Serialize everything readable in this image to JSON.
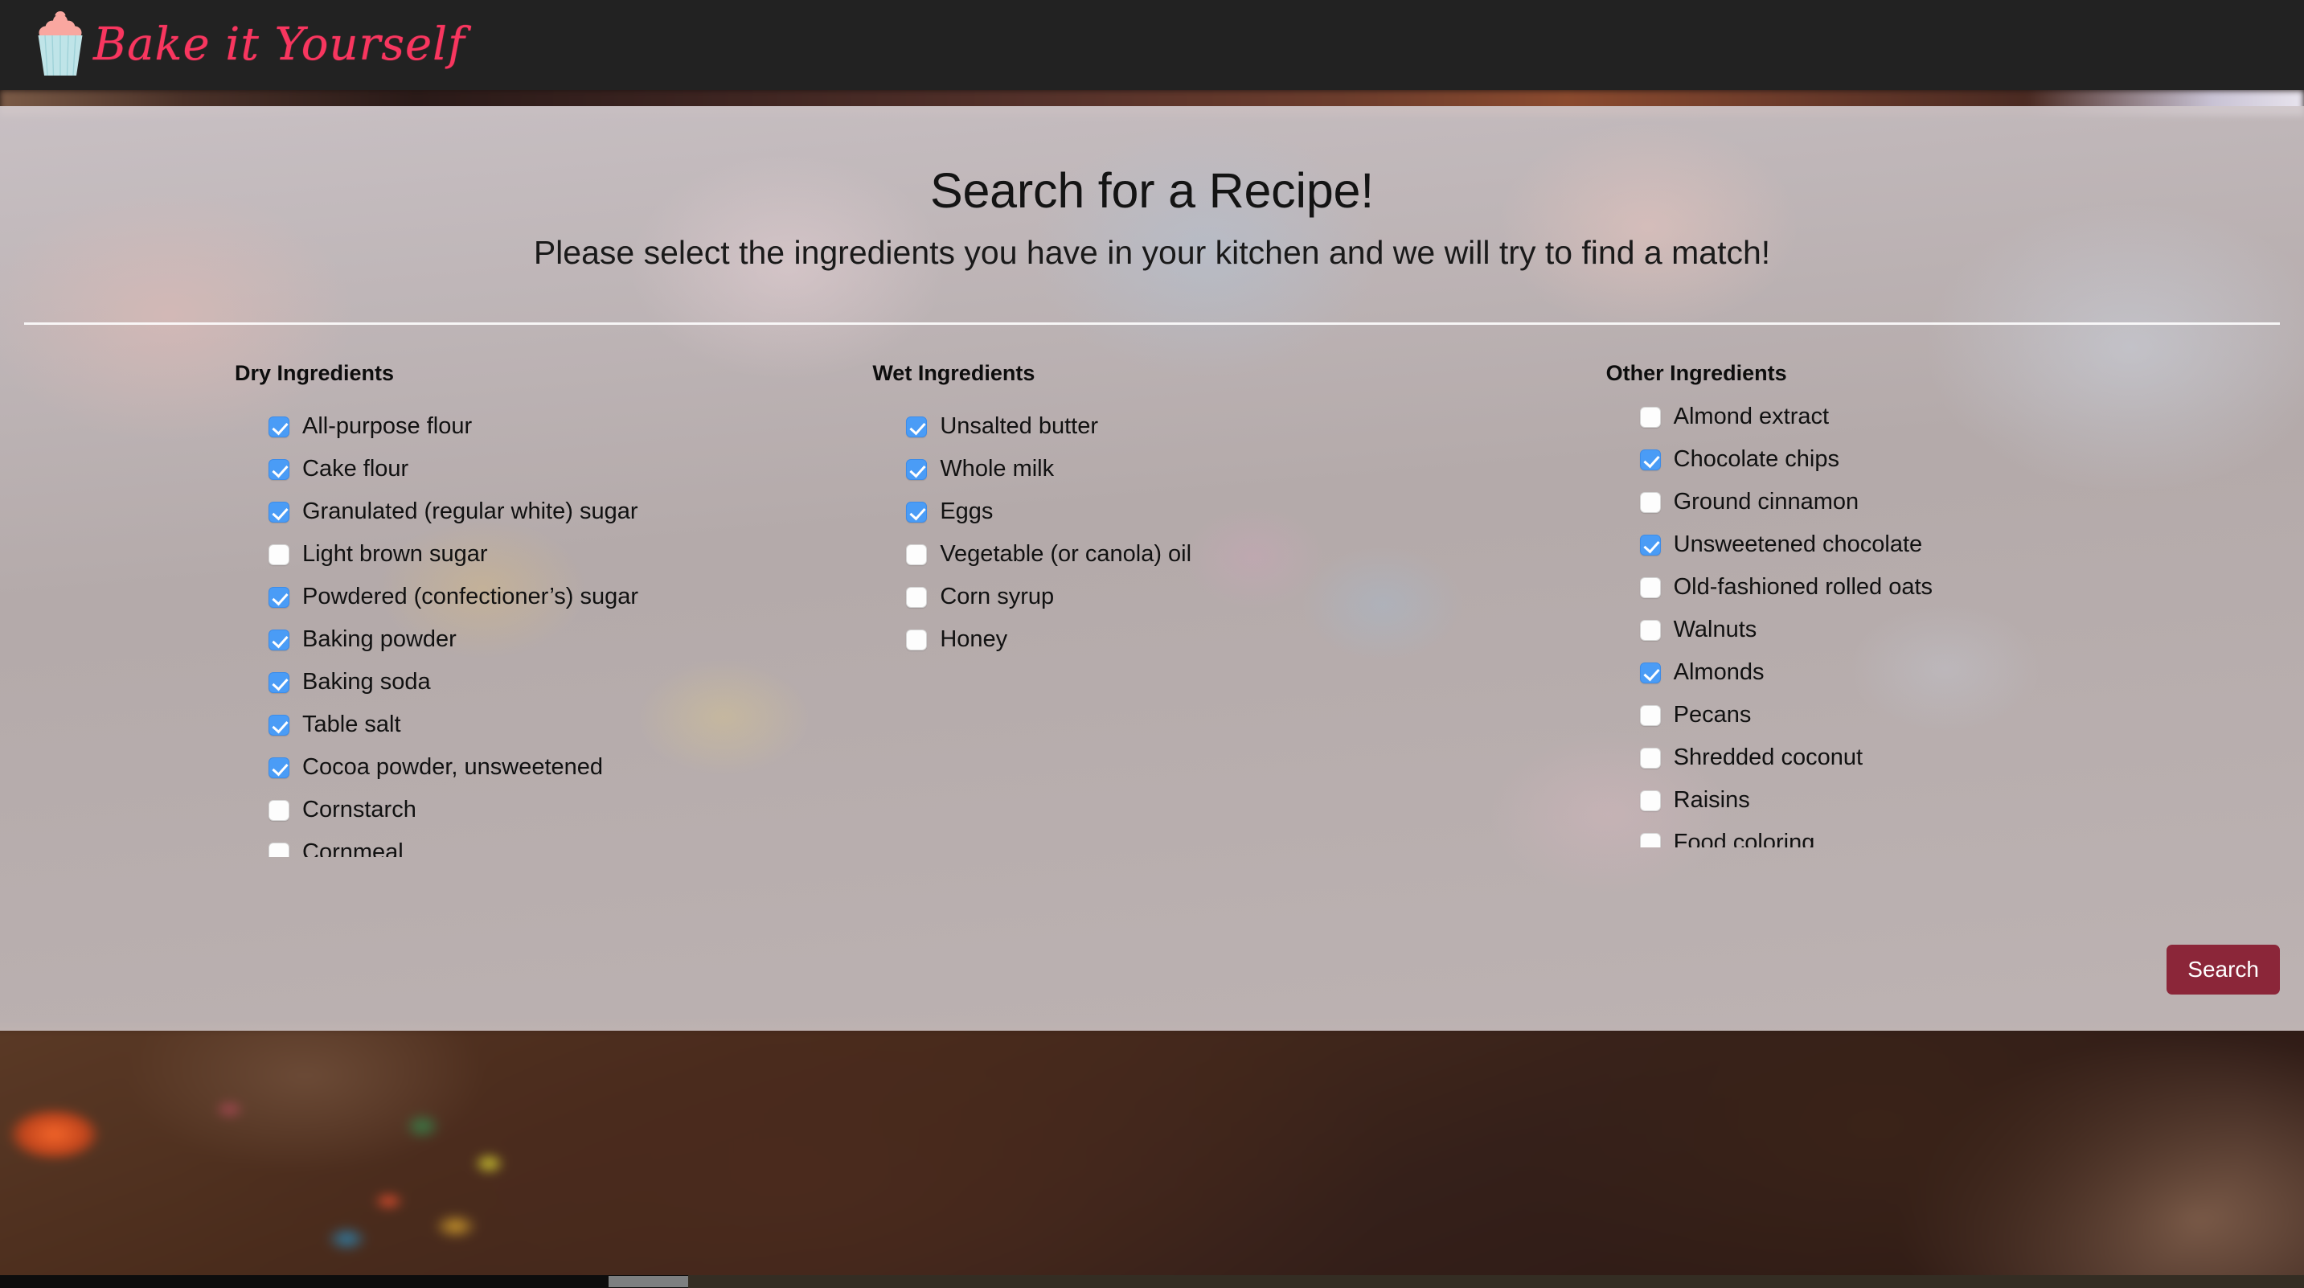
{
  "brand": {
    "name": "Bake it Yourself",
    "logo_icon": "cupcake-icon",
    "accent_color": "#f8365f",
    "frosting_color": "#f9a7a0",
    "liner_color": "#bfe4e8",
    "navbar_color": "#222222"
  },
  "heading": {
    "title": "Search for a Recipe!",
    "subtitle": "Please select the ingredients you have in your kitchen and we will try to find a match!"
  },
  "columns": [
    {
      "id": "dry",
      "heading": "Dry Ingredients",
      "items": [
        {
          "label": "All-purpose flour",
          "checked": true
        },
        {
          "label": "Cake flour",
          "checked": true
        },
        {
          "label": "Granulated (regular white) sugar",
          "checked": true
        },
        {
          "label": "Light brown sugar",
          "checked": false
        },
        {
          "label": "Powdered (confectioner’s) sugar",
          "checked": true
        },
        {
          "label": "Baking powder",
          "checked": true
        },
        {
          "label": "Baking soda",
          "checked": true
        },
        {
          "label": "Table salt",
          "checked": true
        },
        {
          "label": "Cocoa powder, unsweetened",
          "checked": true
        },
        {
          "label": "Cornstarch",
          "checked": false
        },
        {
          "label": "Cornmeal",
          "checked": false
        }
      ]
    },
    {
      "id": "wet",
      "heading": "Wet Ingredients",
      "items": [
        {
          "label": "Unsalted butter",
          "checked": true
        },
        {
          "label": "Whole milk",
          "checked": true
        },
        {
          "label": "Eggs",
          "checked": true
        },
        {
          "label": "Vegetable (or canola) oil",
          "checked": false
        },
        {
          "label": "Corn syrup",
          "checked": false
        },
        {
          "label": "Honey",
          "checked": false
        }
      ]
    },
    {
      "id": "other",
      "heading": "Other Ingredients",
      "items": [
        {
          "label": "Almond extract",
          "checked": false
        },
        {
          "label": "Chocolate chips",
          "checked": true
        },
        {
          "label": "Ground cinnamon",
          "checked": false
        },
        {
          "label": "Unsweetened chocolate",
          "checked": true
        },
        {
          "label": "Old-fashioned rolled oats",
          "checked": false
        },
        {
          "label": "Walnuts",
          "checked": false
        },
        {
          "label": "Almonds",
          "checked": true
        },
        {
          "label": "Pecans",
          "checked": false
        },
        {
          "label": "Shredded coconut",
          "checked": false
        },
        {
          "label": "Raisins",
          "checked": false
        },
        {
          "label": "Food coloring",
          "checked": false
        }
      ]
    }
  ],
  "actions": {
    "search_label": "Search",
    "search_color": "#8b2639"
  },
  "checkbox": {
    "checked_color": "#4a9cf6",
    "unchecked_color": "#fdfdfd"
  }
}
